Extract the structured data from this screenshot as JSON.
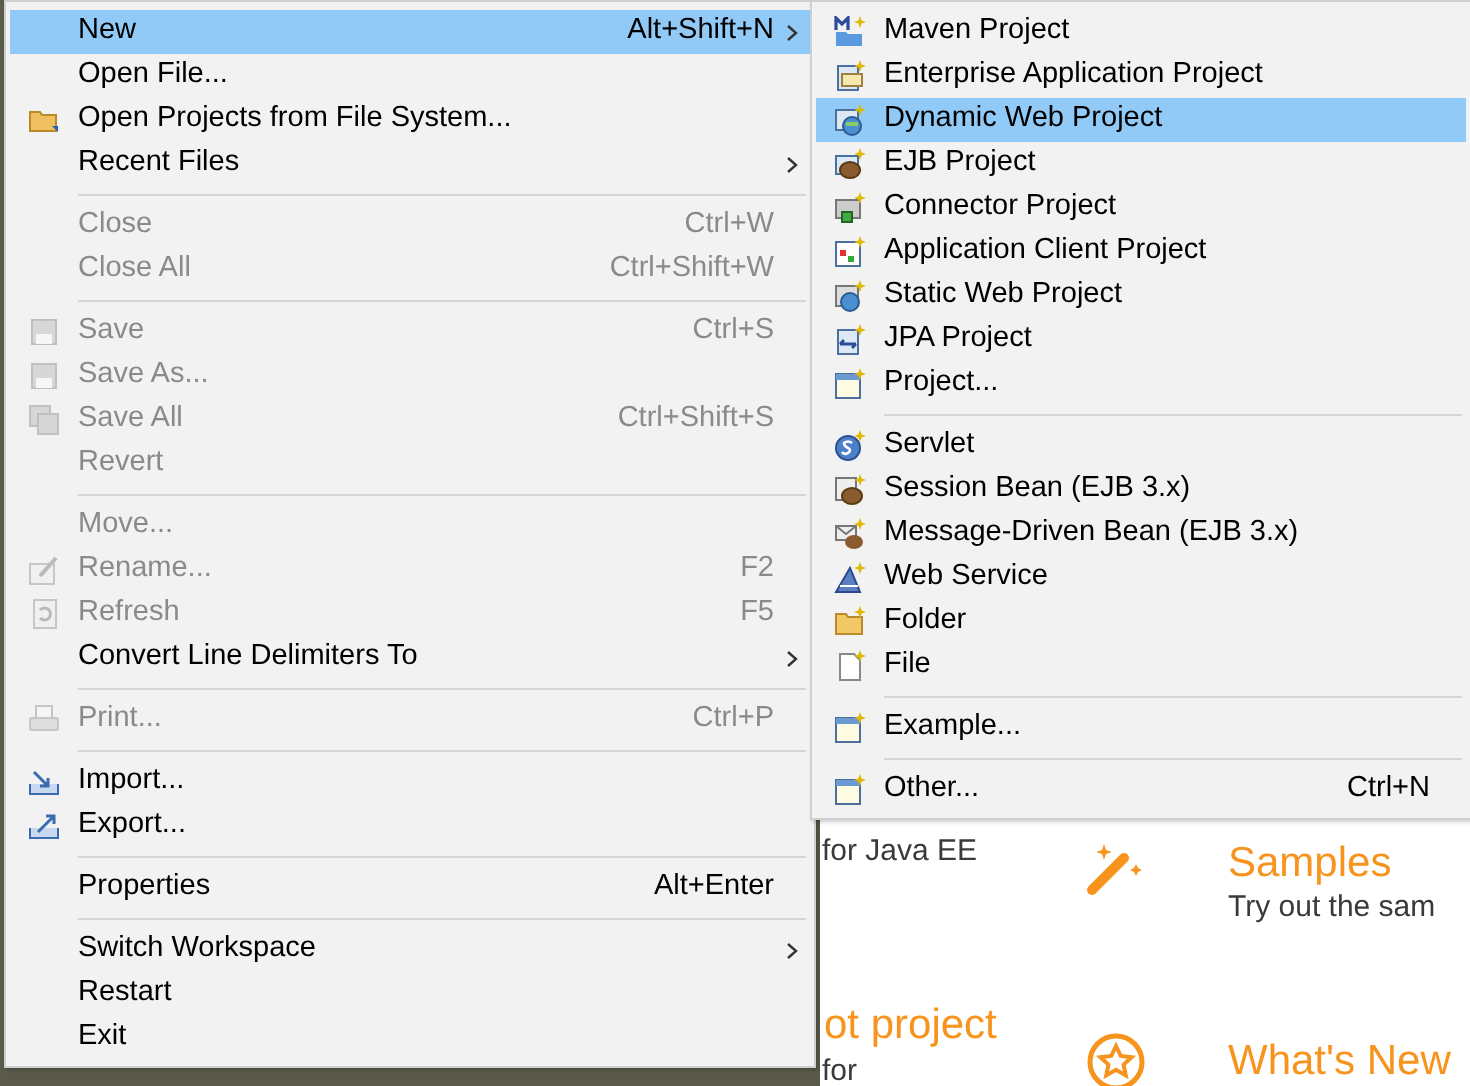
{
  "welcome_page": {
    "texts": [
      {
        "kind": "body",
        "text": "for Java EE"
      },
      {
        "kind": "heading",
        "text": "Samples"
      },
      {
        "kind": "body",
        "text": "Try out the sam"
      },
      {
        "kind": "heading",
        "text": "ot project"
      },
      {
        "kind": "body",
        "text": "for"
      },
      {
        "kind": "heading",
        "text": "What's New"
      }
    ]
  },
  "file_menu": {
    "items": [
      {
        "kind": "item",
        "label": "New",
        "shortcut": "Alt+Shift+N",
        "submenu": true,
        "disabled": false,
        "selected": true
      },
      {
        "kind": "item",
        "label": "Open File...",
        "disabled": false,
        "selected": false
      },
      {
        "kind": "item",
        "label": "Open Projects from File System...",
        "disabled": false,
        "selected": false
      },
      {
        "kind": "item",
        "label": "Recent Files",
        "submenu": true,
        "disabled": false,
        "selected": false
      },
      {
        "kind": "separator"
      },
      {
        "kind": "item",
        "label": "Close",
        "shortcut": "Ctrl+W",
        "disabled": true,
        "selected": false
      },
      {
        "kind": "item",
        "label": "Close All",
        "shortcut": "Ctrl+Shift+W",
        "disabled": true,
        "selected": false
      },
      {
        "kind": "separator"
      },
      {
        "kind": "item",
        "label": "Save",
        "shortcut": "Ctrl+S",
        "disabled": true,
        "selected": false
      },
      {
        "kind": "item",
        "label": "Save As...",
        "disabled": true,
        "selected": false
      },
      {
        "kind": "item",
        "label": "Save All",
        "shortcut": "Ctrl+Shift+S",
        "disabled": true,
        "selected": false
      },
      {
        "kind": "item",
        "label": "Revert",
        "disabled": true,
        "selected": false
      },
      {
        "kind": "separator"
      },
      {
        "kind": "item",
        "label": "Move...",
        "disabled": true,
        "selected": false
      },
      {
        "kind": "item",
        "label": "Rename...",
        "shortcut": "F2",
        "disabled": true,
        "selected": false
      },
      {
        "kind": "item",
        "label": "Refresh",
        "shortcut": "F5",
        "disabled": true,
        "selected": false
      },
      {
        "kind": "item",
        "label": "Convert Line Delimiters To",
        "submenu": true,
        "disabled": false,
        "selected": false
      },
      {
        "kind": "separator"
      },
      {
        "kind": "item",
        "label": "Print...",
        "shortcut": "Ctrl+P",
        "disabled": true,
        "selected": false
      },
      {
        "kind": "separator"
      },
      {
        "kind": "item",
        "label": "Import...",
        "disabled": false,
        "selected": false
      },
      {
        "kind": "item",
        "label": "Export...",
        "disabled": false,
        "selected": false
      },
      {
        "kind": "separator"
      },
      {
        "kind": "item",
        "label": "Properties",
        "shortcut": "Alt+Enter",
        "disabled": false,
        "selected": false
      },
      {
        "kind": "separator"
      },
      {
        "kind": "item",
        "label": "Switch Workspace",
        "submenu": true,
        "disabled": false,
        "selected": false
      },
      {
        "kind": "item",
        "label": "Restart",
        "disabled": false,
        "selected": false
      },
      {
        "kind": "item",
        "label": "Exit",
        "disabled": false,
        "selected": false
      }
    ]
  },
  "new_submenu": {
    "items": [
      {
        "kind": "item",
        "label": "Maven Project",
        "selected": false
      },
      {
        "kind": "item",
        "label": "Enterprise Application Project",
        "selected": false
      },
      {
        "kind": "item",
        "label": "Dynamic Web Project",
        "selected": true
      },
      {
        "kind": "item",
        "label": "EJB Project",
        "selected": false
      },
      {
        "kind": "item",
        "label": "Connector Project",
        "selected": false
      },
      {
        "kind": "item",
        "label": "Application Client Project",
        "selected": false
      },
      {
        "kind": "item",
        "label": "Static Web Project",
        "selected": false
      },
      {
        "kind": "item",
        "label": "JPA Project",
        "selected": false
      },
      {
        "kind": "item",
        "label": "Project...",
        "selected": false
      },
      {
        "kind": "separator"
      },
      {
        "kind": "item",
        "label": "Servlet",
        "selected": false
      },
      {
        "kind": "item",
        "label": "Session Bean (EJB 3.x)",
        "selected": false
      },
      {
        "kind": "item",
        "label": "Message-Driven Bean (EJB 3.x)",
        "selected": false
      },
      {
        "kind": "item",
        "label": "Web Service",
        "selected": false
      },
      {
        "kind": "item",
        "label": "Folder",
        "selected": false
      },
      {
        "kind": "item",
        "label": "File",
        "selected": false
      },
      {
        "kind": "separator"
      },
      {
        "kind": "item",
        "label": "Example...",
        "selected": false
      },
      {
        "kind": "separator"
      },
      {
        "kind": "item",
        "label": "Other...",
        "shortcut": "Ctrl+N",
        "selected": false
      }
    ]
  }
}
